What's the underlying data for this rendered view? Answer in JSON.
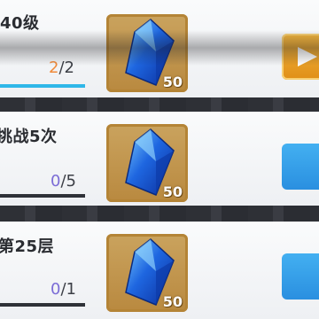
{
  "quests": [
    {
      "title": "40级",
      "current": "2",
      "total": "/2",
      "progress": 1.0,
      "reward_qty": "50",
      "reward_icon": "blue-crystal-icon",
      "action": "go-button-play"
    },
    {
      "title": "挑战5次",
      "current": "0",
      "total": "/5",
      "progress": 0.0,
      "reward_qty": "50",
      "reward_icon": "blue-crystal-icon",
      "action": "go-button"
    },
    {
      "title": "第25层",
      "current": "0",
      "total": "/1",
      "progress": 0.0,
      "reward_qty": "50",
      "reward_icon": "blue-crystal-icon",
      "action": "go-button"
    }
  ],
  "colors": {
    "progress_fill": "#2fb7e8",
    "done_count": "#f08a3a",
    "pending_count": "#7b6cd6",
    "play_button": "#e08f17",
    "go_button": "#2a8fe0",
    "reward_frame": "#b9893f"
  }
}
